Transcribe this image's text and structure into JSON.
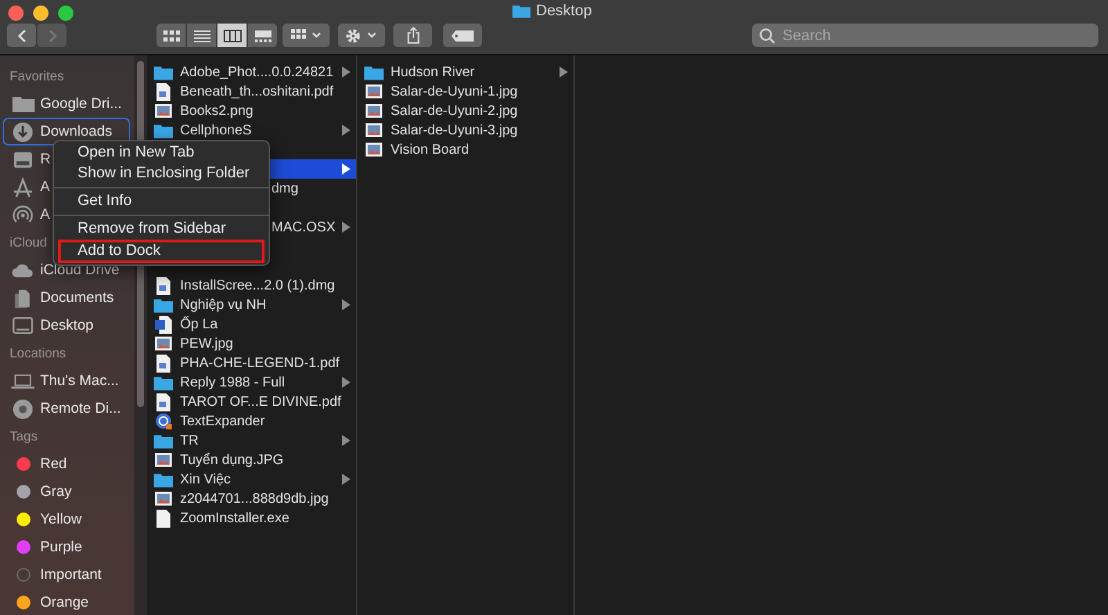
{
  "window": {
    "title": "Desktop"
  },
  "toolbar": {
    "view_modes": [
      {
        "kind": "icons",
        "selected": false
      },
      {
        "kind": "list",
        "selected": false
      },
      {
        "kind": "columns",
        "selected": true
      },
      {
        "kind": "gallery",
        "selected": false
      }
    ],
    "search": {
      "placeholder": "Search"
    }
  },
  "sidebar": {
    "sections": [
      {
        "title": "Favorites",
        "items": [
          {
            "label": "Google Dri...",
            "kind": "folder",
            "selected": false
          },
          {
            "label": "Downloads",
            "kind": "download",
            "selected": true
          },
          {
            "label": "R",
            "kind": "drive",
            "selected": false
          },
          {
            "label": "A",
            "kind": "apps",
            "selected": false
          },
          {
            "label": "A",
            "kind": "airdrop",
            "selected": false
          }
        ]
      },
      {
        "title": "iCloud",
        "items": [
          {
            "label": "iCloud Drive",
            "kind": "cloud",
            "selected": false
          },
          {
            "label": "Documents",
            "kind": "documents",
            "selected": false
          },
          {
            "label": "Desktop",
            "kind": "desktop",
            "selected": false
          }
        ]
      },
      {
        "title": "Locations",
        "items": [
          {
            "label": "Thu's Mac...",
            "kind": "laptop",
            "selected": false
          },
          {
            "label": "Remote Di...",
            "kind": "disc",
            "selected": false
          }
        ]
      },
      {
        "title": "Tags",
        "items": [
          {
            "label": "Red",
            "kind": "tag",
            "color": "#ff3b4f",
            "selected": false
          },
          {
            "label": "Gray",
            "kind": "tag",
            "color": "#a3a3ab",
            "selected": false
          },
          {
            "label": "Yellow",
            "kind": "tag",
            "color": "#ffee00",
            "selected": false
          },
          {
            "label": "Purple",
            "kind": "tag",
            "color": "#e040f5",
            "selected": false
          },
          {
            "label": "Important",
            "kind": "tag-outline",
            "color": "#6a6a6a",
            "selected": false
          },
          {
            "label": "Orange",
            "kind": "tag",
            "color": "#ffa51e",
            "selected": false
          }
        ]
      }
    ]
  },
  "columns": [
    {
      "rows": [
        {
          "name": "Adobe_Phot....0.0.24821",
          "kind": "folder",
          "arrow": true,
          "selected": false
        },
        {
          "name": "Beneath_th...oshitani.pdf",
          "kind": "pdf",
          "arrow": false,
          "selected": false
        },
        {
          "name": "Books2.png",
          "kind": "image",
          "arrow": false,
          "selected": false
        },
        {
          "name": "CellphoneS",
          "kind": "folder",
          "arrow": true,
          "selected": false
        },
        {
          "kind": "hidden"
        },
        {
          "kind": "hidden",
          "arrow": true,
          "selected": true
        },
        {
          "name": "dmg",
          "kind": "hidden",
          "arrow": false,
          "selected": false
        },
        {
          "kind": "hidden"
        },
        {
          "name": "MAC.OSX",
          "kind": "hidden",
          "arrow": true,
          "selected": false
        },
        {
          "kind": "hidden"
        },
        {
          "kind": "hidden"
        },
        {
          "name": "InstallScree...2.0 (1).dmg",
          "kind": "pdf",
          "arrow": false,
          "selected": false
        },
        {
          "name": "Nghiệp vụ NH",
          "kind": "folder",
          "arrow": true,
          "selected": false
        },
        {
          "name": "Ốp La",
          "kind": "word",
          "arrow": false,
          "selected": false
        },
        {
          "name": "PEW.jpg",
          "kind": "image",
          "arrow": false,
          "selected": false
        },
        {
          "name": "PHA-CHE-LEGEND-1.pdf",
          "kind": "pdf",
          "arrow": false,
          "selected": false
        },
        {
          "name": "Reply 1988 - Full",
          "kind": "folder",
          "arrow": true,
          "selected": false
        },
        {
          "name": "TAROT OF...E DIVINE.pdf",
          "kind": "pdf",
          "arrow": false,
          "selected": false
        },
        {
          "name": "TextExpander",
          "kind": "app",
          "arrow": false,
          "selected": false
        },
        {
          "name": "TR",
          "kind": "folder",
          "arrow": true,
          "selected": false
        },
        {
          "name": "Tuyển dụng.JPG",
          "kind": "image",
          "arrow": false,
          "selected": false
        },
        {
          "name": "Xin Việc",
          "kind": "folder",
          "arrow": true,
          "selected": false
        },
        {
          "name": "z2044701...888d9db.jpg",
          "kind": "image",
          "arrow": false,
          "selected": false
        },
        {
          "name": "ZoomInstaller.exe",
          "kind": "file",
          "arrow": false,
          "selected": false
        }
      ]
    },
    {
      "rows": [
        {
          "name": "Hudson River",
          "kind": "folder",
          "arrow": true,
          "selected": false
        },
        {
          "name": "Salar-de-Uyuni-1.jpg",
          "kind": "image",
          "arrow": false,
          "selected": false
        },
        {
          "name": "Salar-de-Uyuni-2.jpg",
          "kind": "image",
          "arrow": false,
          "selected": false
        },
        {
          "name": "Salar-de-Uyuni-3.jpg",
          "kind": "image",
          "arrow": false,
          "selected": false
        },
        {
          "name": "Vision Board",
          "kind": "image",
          "arrow": false,
          "selected": false
        }
      ]
    }
  ],
  "context_menu": {
    "groups": [
      [
        {
          "label": "Open in New Tab",
          "highlighted": false
        },
        {
          "label": "Show in Enclosing Folder",
          "highlighted": false
        }
      ],
      [
        {
          "label": "Get Info",
          "highlighted": false
        }
      ],
      [
        {
          "label": "Remove from Sidebar",
          "highlighted": false
        },
        {
          "label": "Add to Dock",
          "highlighted": true
        }
      ]
    ]
  }
}
